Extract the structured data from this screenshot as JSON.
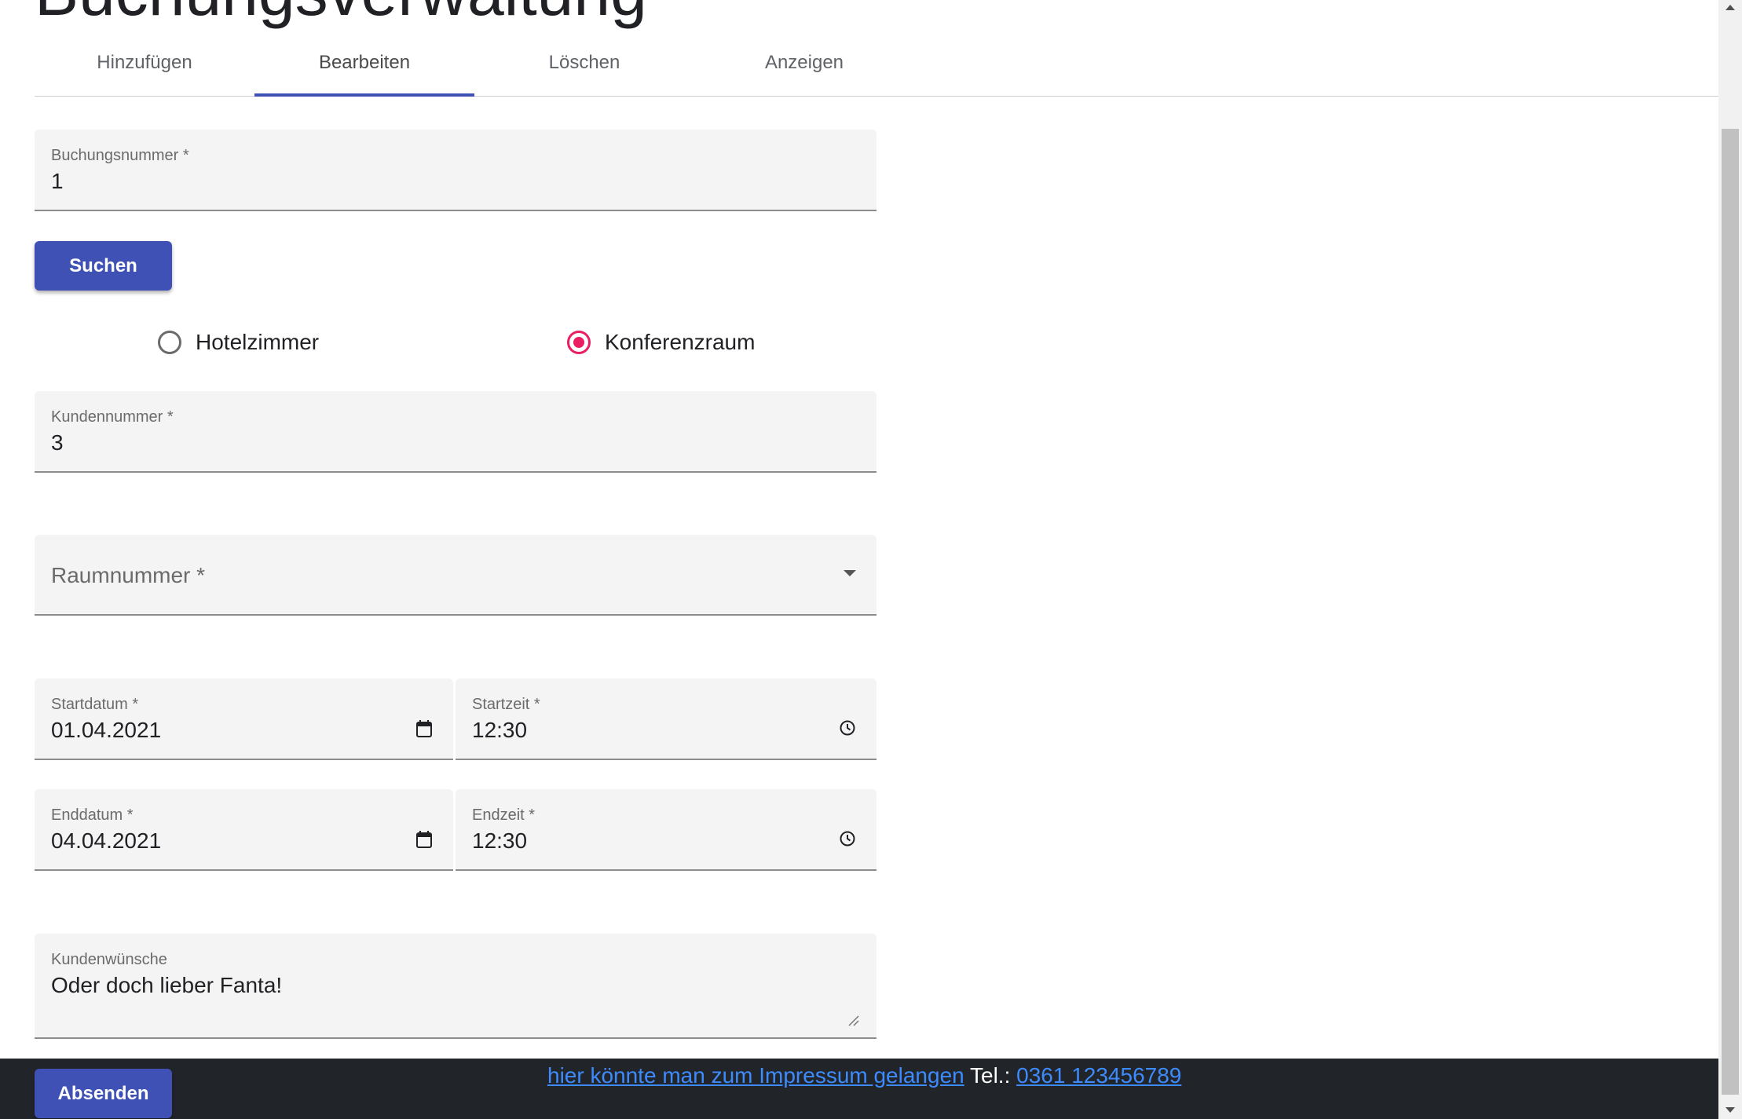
{
  "page": {
    "title": "Buchungsverwaltung"
  },
  "tabs": [
    {
      "label": "Hinzufügen"
    },
    {
      "label": "Bearbeiten",
      "active": true
    },
    {
      "label": "Löschen"
    },
    {
      "label": "Anzeigen"
    }
  ],
  "form": {
    "booking_number": {
      "label": "Buchungsnummer *",
      "value": "1"
    },
    "search_button": "Suchen",
    "room_type": {
      "options": [
        {
          "label": "Hotelzimmer",
          "checked": false
        },
        {
          "label": "Konferenzraum",
          "checked": true
        }
      ]
    },
    "customer_number": {
      "label": "Kundennummer *",
      "value": "3"
    },
    "room_number": {
      "placeholder": "Raumnummer *",
      "value": ""
    },
    "start_date": {
      "label": "Startdatum *",
      "value": "01.04.2021",
      "icon": "calendar-icon"
    },
    "start_time": {
      "label": "Startzeit *",
      "value": "12:30",
      "icon": "clock-icon"
    },
    "end_date": {
      "label": "Enddatum *",
      "value": "04.04.2021",
      "icon": "calendar-icon"
    },
    "end_time": {
      "label": "Endzeit *",
      "value": "12:30",
      "icon": "clock-icon"
    },
    "wishes": {
      "label": "Kundenwünsche",
      "value": "Oder doch lieber Fanta!"
    },
    "submit_button": "Absenden"
  },
  "footer": {
    "impressum_link": "hier könnte man zum Impressum gelangen",
    "phone_prefix": "Tel.:",
    "phone_link": "0361 123456789"
  },
  "colors": {
    "primary": "#3f51b5",
    "accent": "#e91e63",
    "footer_bg": "#212529",
    "link": "#3d8bfd"
  }
}
